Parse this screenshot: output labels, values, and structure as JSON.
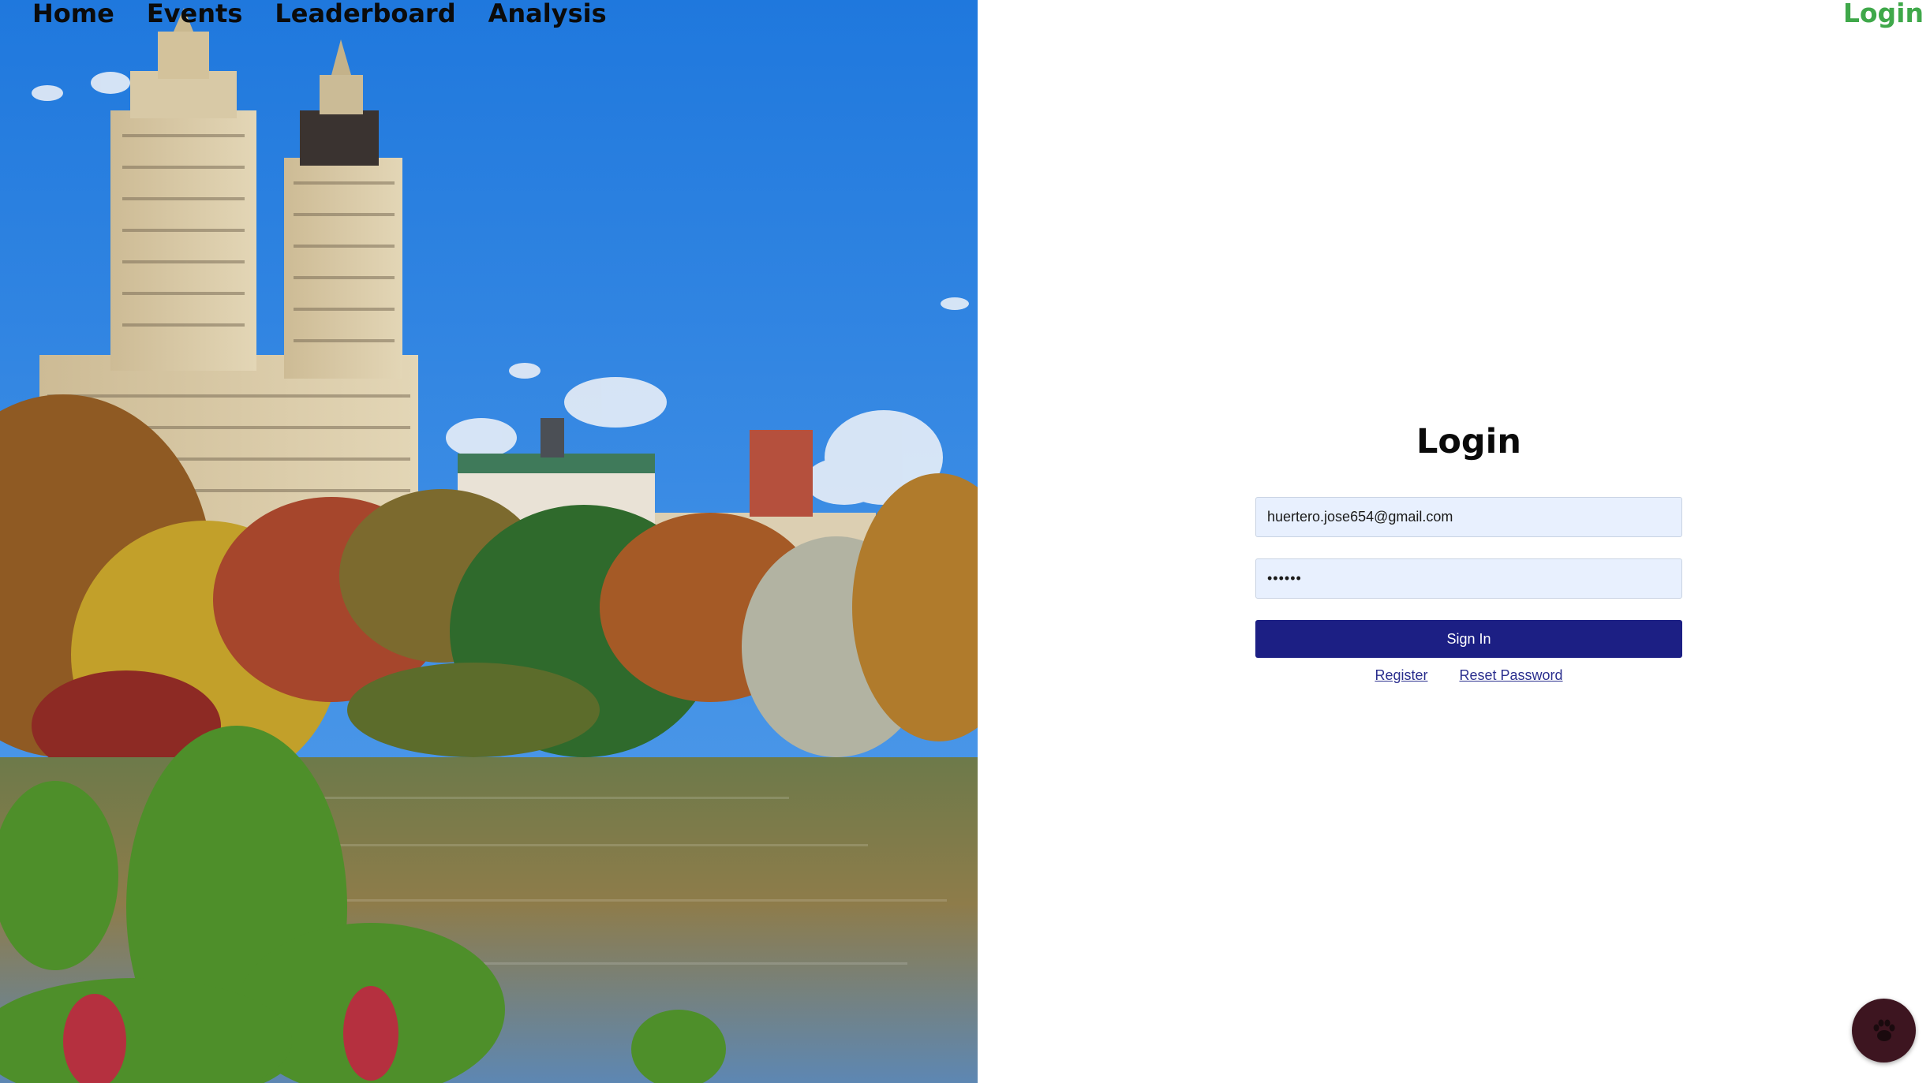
{
  "nav": {
    "items": [
      {
        "label": "Home"
      },
      {
        "label": "Events"
      },
      {
        "label": "Leaderboard"
      },
      {
        "label": "Analysis"
      }
    ],
    "login_link": "Login"
  },
  "login_form": {
    "title": "Login",
    "email_value": "huertero.jose654@gmail.com",
    "password_value": "••••••",
    "submit_label": "Sign In",
    "register_link": "Register",
    "reset_link": "Reset Password"
  },
  "hero_image": {
    "subject": "city towers above autumn trees and a lake"
  },
  "chat_button": {
    "icon": "paw-icon"
  },
  "colors": {
    "accent_login": "#3fa84a",
    "button_primary": "#1c1f84",
    "input_bg": "#e8f0fe",
    "link": "#2b2f8e",
    "fab": "#3d1520"
  }
}
